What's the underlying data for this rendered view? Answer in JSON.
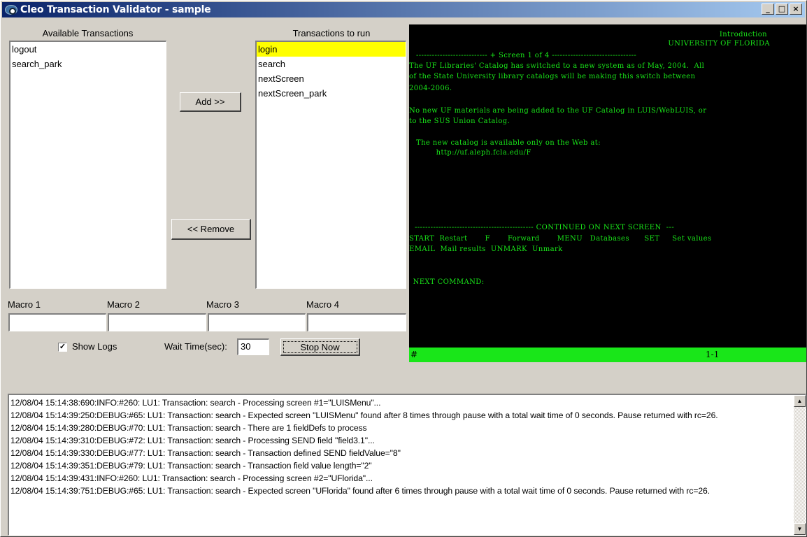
{
  "window": {
    "title": "Cleo Transaction Validator - sample",
    "minimize_glyph": "_",
    "maximize_glyph": "□",
    "close_glyph": "×"
  },
  "available": {
    "label": "Available Transactions",
    "items": [
      "logout",
      "search_park"
    ]
  },
  "to_run": {
    "label": "Transactions to run",
    "items": [
      "login",
      "search",
      "nextScreen",
      "nextScreen_park"
    ],
    "selected_index": 0
  },
  "buttons": {
    "add": "Add >>",
    "remove": "<< Remove",
    "stop": "Stop Now"
  },
  "macros": [
    {
      "label": "Macro 1",
      "value": ""
    },
    {
      "label": "Macro 2",
      "value": ""
    },
    {
      "label": "Macro 3",
      "value": ""
    },
    {
      "label": "Macro 4",
      "value": ""
    }
  ],
  "options": {
    "show_logs_label": "Show Logs",
    "show_logs_checked": true,
    "check_glyph": "✓",
    "wait_time_label": "Wait Time(sec):",
    "wait_time_value": "30"
  },
  "terminal": {
    "lines": [
      "Introduction",
      "UNIVERSITY OF FLORIDA",
      "--------------------------- + Screen 1 of 4 --------------------------------",
      "The UF Libraries' Catalog has switched to a new system as of May, 2004.  All",
      "of the State University library catalogs will be making this switch between",
      "2004-2006.",
      "No new UF materials are being added to the UF Catalog in LUIS/WebLUIS, or",
      "to the SUS Union Catalog.",
      "The new catalog is available only on the Web at:",
      "        http://uf.aleph.fcla.edu/F",
      "--------------------------------------------- CONTINUED ON NEXT SCREEN  ---",
      "START  Restart       F       Forward       MENU   Databases      SET     Set values",
      "EMAIL  Mail results  UNMARK  Unmark",
      " NEXT COMMAND:"
    ],
    "status_left": "#",
    "status_right": "1-1",
    "fg_color": "#19e619",
    "bg_color": "#000000"
  },
  "log": {
    "lines": [
      "12/08/04 15:14:38:690:INFO:#260: LU1: Transaction: search - Processing screen #1=\"LUISMenu\"...",
      "12/08/04 15:14:39:250:DEBUG:#65: LU1: Transaction: search - Expected screen \"LUISMenu\" found after 8 times through pause with a total wait time of 0 seconds. Pause returned with rc=26.",
      "12/08/04 15:14:39:280:DEBUG:#70: LU1: Transaction: search - There are 1 fieldDefs to process",
      "12/08/04 15:14:39:310:DEBUG:#72: LU1: Transaction: search - Processing SEND field \"field3.1\"...",
      "12/08/04 15:14:39:330:DEBUG:#77: LU1: Transaction: search - Transaction defined SEND fieldValue=\"8\"",
      "12/08/04 15:14:39:351:DEBUG:#79: LU1: Transaction: search - Transaction field value length=\"2\"",
      "12/08/04 15:14:39:431:INFO:#260: LU1: Transaction: search - Processing screen #2=\"UFlorida\"...",
      "12/08/04 15:14:39:751:DEBUG:#65: LU1: Transaction: search - Expected screen \"UFlorida\" found after 6 times through pause with a total wait time of 0 seconds. Pause returned with rc=26."
    ],
    "scroll_up_glyph": "▲",
    "scroll_down_glyph": "▼"
  }
}
